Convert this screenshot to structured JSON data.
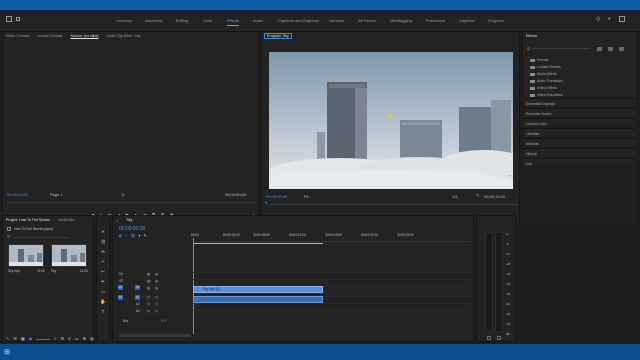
{
  "workspaces": [
    "Learning",
    "Assembly",
    "Editing",
    "Color",
    "Effects",
    "Audio",
    "Captions and Graphics",
    "Libraries",
    "All Panels",
    "Metalogging",
    "Production",
    "Captions",
    "Graphics"
  ],
  "active_workspace": "Effects",
  "source_panel": {
    "tabs": [
      "Effect Controls",
      "Lumetri Scopes",
      "Source: (no clips)",
      "Audio Clip Mixer: Sky"
    ],
    "active_tab": "Source: (no clips)",
    "timecode_in": "00;00;00;00",
    "page": "Page 1",
    "timecode_out": "00;00;00;00"
  },
  "program_monitor": {
    "tab": "Program: Sky",
    "timecode_in": "00:00:00:00",
    "fit": "Fit",
    "quality": "1/2",
    "timecode_out": "00:00:11:00"
  },
  "effects_panel": {
    "tab": "Effects",
    "items": [
      "Presets",
      "Lumetri Presets",
      "Audio Effects",
      "Audio Transitions",
      "Video Effects",
      "Video Transitions"
    ],
    "sections": [
      "Essential Graphics",
      "Essential Sound",
      "Lumetri Color",
      "Libraries",
      "Markers",
      "History",
      "Info"
    ]
  },
  "project_panel": {
    "tabs": [
      "Project: How To Full Screen",
      "Media Brc"
    ],
    "project_file": "How To Full Screen.prproj",
    "items": [
      {
        "name": "Sky.mp4",
        "duration": "11:00"
      },
      {
        "name": "Sky",
        "duration": "11:00"
      }
    ]
  },
  "timeline": {
    "tab": "Sky",
    "timecode": "00:00:00:00",
    "ruler": [
      "00:00",
      "00:00:04:00",
      "00:00:08:00",
      "00:00:12:00",
      "00:00:16:00",
      "00:00:20:00",
      "00:00:24:00"
    ],
    "tracks": [
      "V3",
      "V2",
      "V1",
      "A1",
      "A2",
      "A3"
    ],
    "clip_label": "Sky.mp4 [V]",
    "mix_label": "Mix",
    "mix_value": "0.0"
  },
  "audio_meter": {
    "labels": [
      "0",
      "-6",
      "-12",
      "-18",
      "-24",
      "-30",
      "-36",
      "-42",
      "-48",
      "-54",
      "dB"
    ]
  }
}
